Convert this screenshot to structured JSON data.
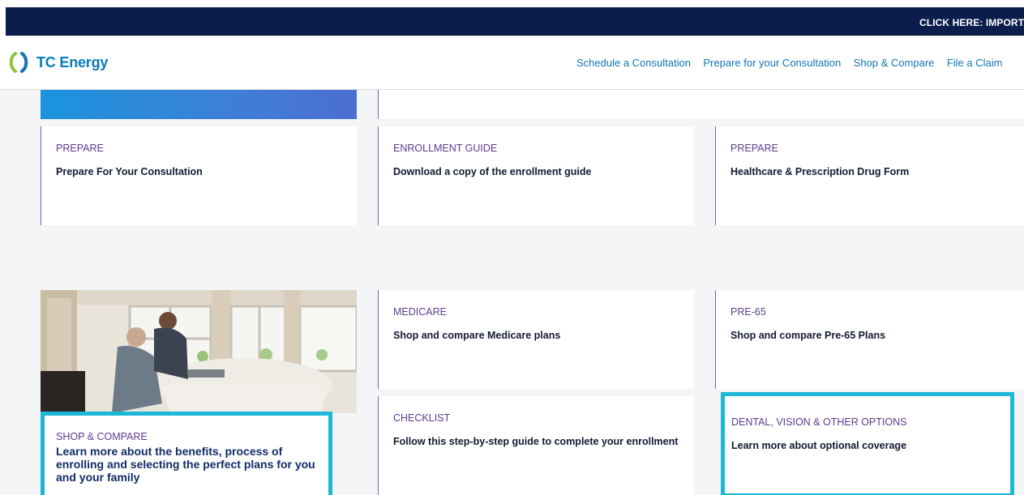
{
  "topbar": {
    "text": "CLICK HERE:  IMPORTANT"
  },
  "header": {
    "logo_text": "TC Energy",
    "nav": [
      "Schedule a Consultation",
      "Prepare for your Consultation",
      "Shop & Compare",
      "File a Claim"
    ]
  },
  "cards": {
    "prepare_consultation": {
      "category": "PREPARE",
      "title": "Prepare For Your Consultation"
    },
    "enrollment_guide": {
      "category": "ENROLLMENT GUIDE",
      "title": "Download a copy of the enrollment guide"
    },
    "prepare_form": {
      "category": "PREPARE",
      "title": "Healthcare & Prescription Drug Form"
    },
    "medicare": {
      "category": "MEDICARE",
      "title": "Shop and compare Medicare plans"
    },
    "pre65": {
      "category": "PRE-65",
      "title": "Shop and compare Pre-65 Plans"
    },
    "checklist": {
      "category": "CHECKLIST",
      "title": "Follow this step-by-step guide to complete your enrollment"
    },
    "dental": {
      "category": "DENTAL, VISION & OTHER OPTIONS",
      "title": "Learn more about optional coverage"
    },
    "shop_compare": {
      "category": "SHOP & COMPARE",
      "title": "Learn more about the benefits, process of enrolling and selecting the perfect plans for you and your family"
    }
  },
  "colors": {
    "topbar_bg": "#0b1d4c",
    "brand_blue": "#0a7bb8",
    "card_accent": "#7b5fa6",
    "highlight": "#1db8d8"
  },
  "icons": {
    "logo": "tc-energy-logo-icon"
  }
}
